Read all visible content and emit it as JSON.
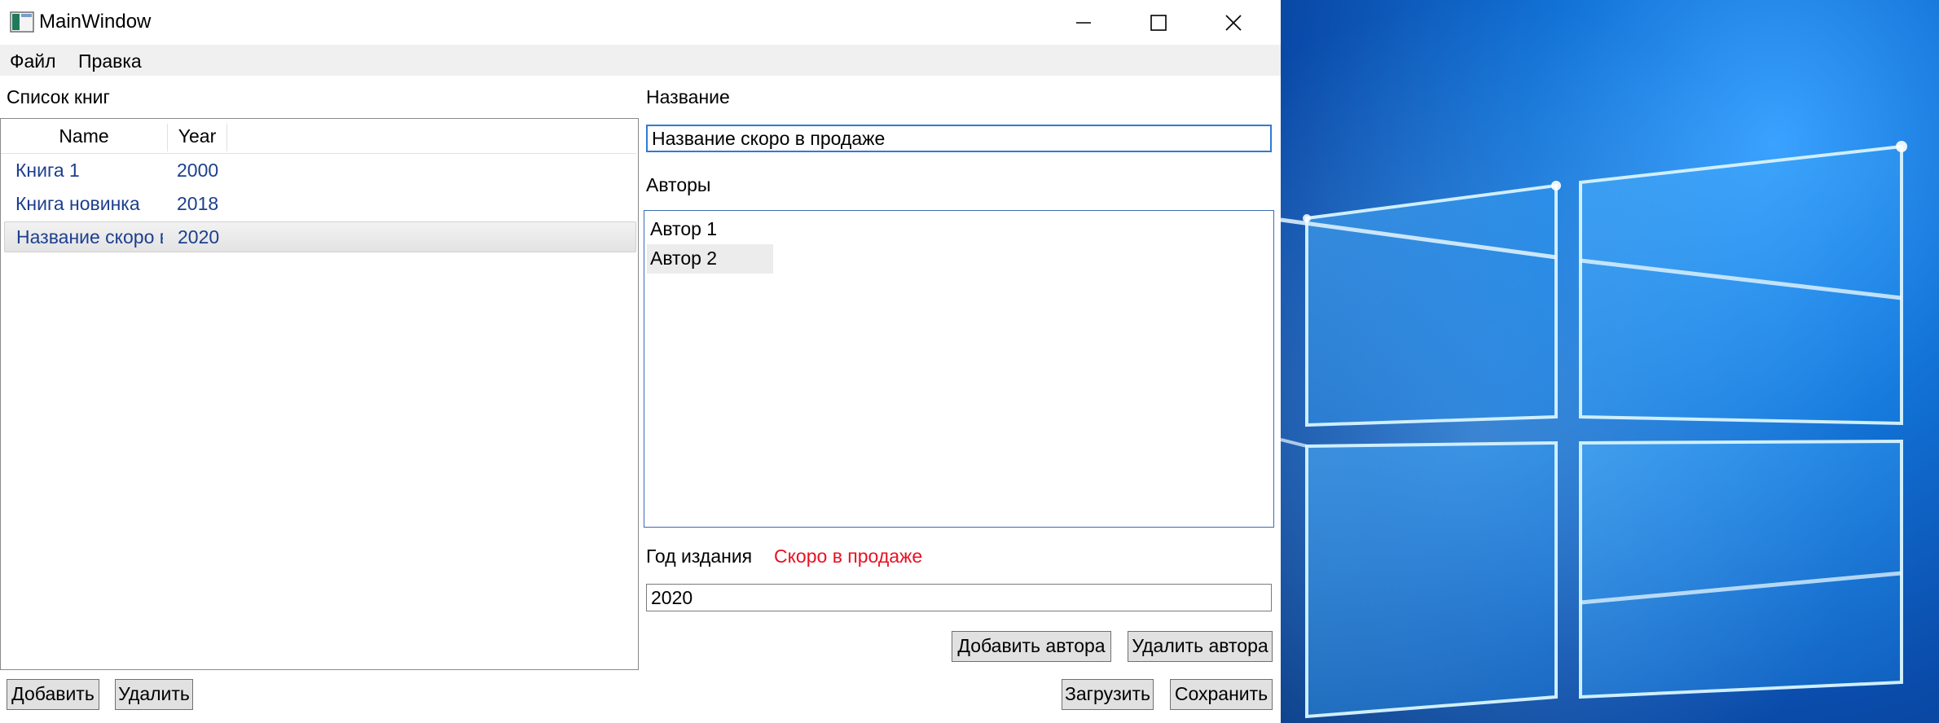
{
  "window": {
    "title": "MainWindow"
  },
  "menu": [
    "Файл",
    "Правка"
  ],
  "books_panel": {
    "label": "Список книг",
    "columns": [
      "Name",
      "Year"
    ],
    "rows": [
      {
        "name": "Книга 1",
        "year": "2000"
      },
      {
        "name": "Книга новинка",
        "year": "2018"
      },
      {
        "name": "Название скоро в продаже",
        "year": "2020"
      }
    ],
    "selected_index": 2
  },
  "details": {
    "title_label": "Название",
    "title_value": "Название скоро в продаже",
    "authors_label": "Авторы",
    "authors": [
      "Автор 1",
      "Автор 2"
    ],
    "selected_author_index": 1,
    "year_label": "Год издания",
    "year_status": "Скоро в продаже",
    "year_value": "2020"
  },
  "buttons": {
    "add_author": "Добавить автора",
    "remove_author": "Удалить автора",
    "add": "Добавить",
    "remove": "Удалить",
    "load": "Загрузить",
    "save": "Сохранить"
  },
  "colors": {
    "list_text": "#1c3f8f",
    "status_text": "#e81123",
    "focus_border": "#2f7bd6"
  }
}
